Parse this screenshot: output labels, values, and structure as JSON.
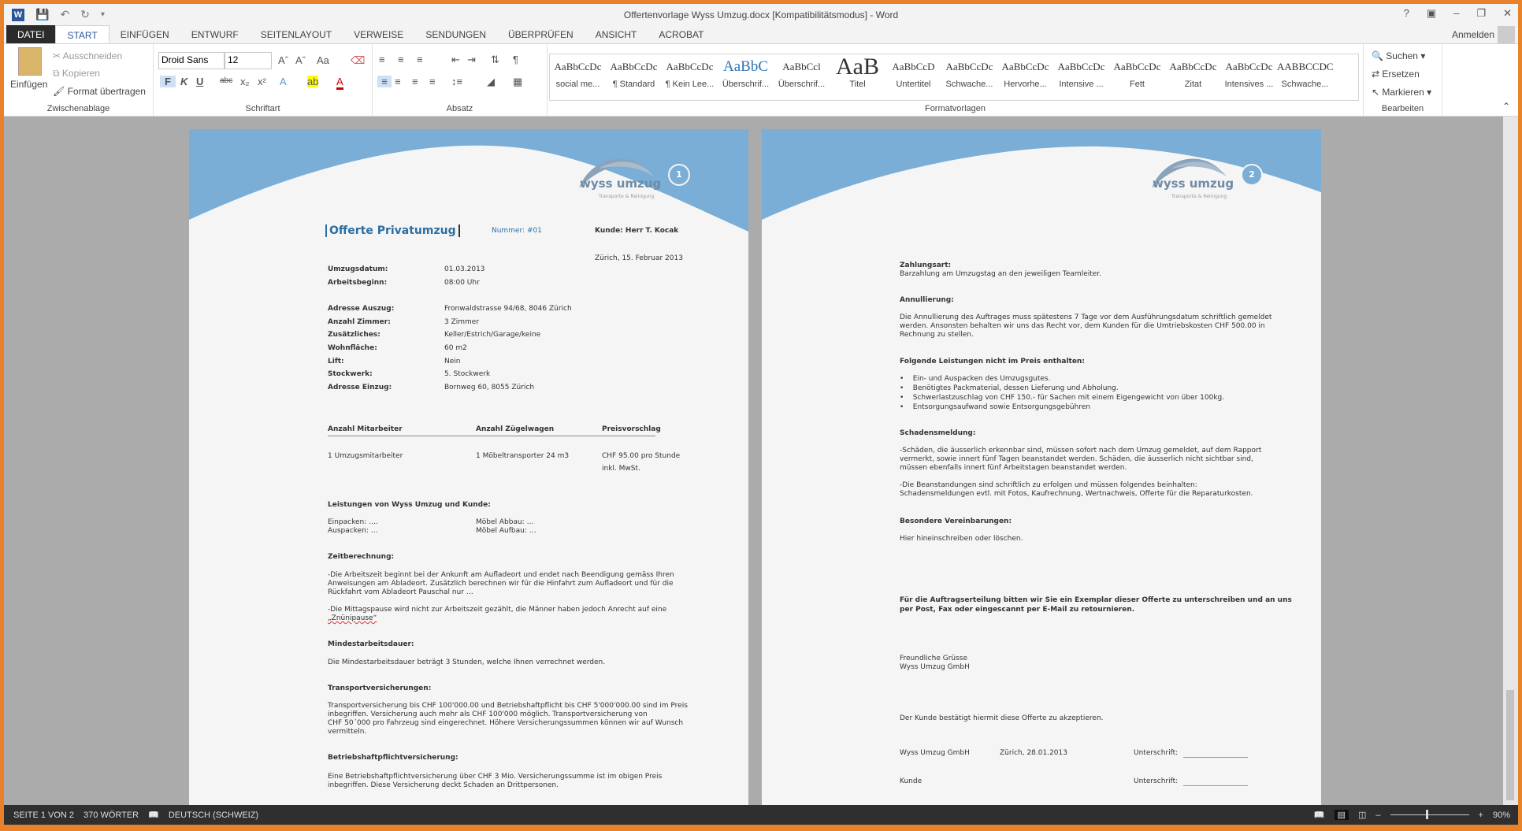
{
  "window": {
    "title": "Offertenvorlage Wyss Umzug.docx [Kompatibilitätsmodus] - Word",
    "help": "?",
    "signin": "Anmelden"
  },
  "tabs": [
    "DATEI",
    "START",
    "EINFÜGEN",
    "ENTWURF",
    "SEITENLAYOUT",
    "VERWEISE",
    "SENDUNGEN",
    "ÜBERPRÜFEN",
    "ANSICHT",
    "ACROBAT"
  ],
  "ribbon": {
    "clipboard": {
      "paste": "Einfügen",
      "cut": "Ausschneiden",
      "copy": "Kopieren",
      "format_painter": "Format übertragen",
      "label": "Zwischenablage"
    },
    "font": {
      "name": "Droid Sans",
      "size": "12",
      "label": "Schriftart",
      "bold": "F",
      "italic": "K",
      "underline": "U",
      "strike": "abc",
      "case": "Aa"
    },
    "paragraph": {
      "label": "Absatz"
    },
    "styles": {
      "label": "Formatvorlagen",
      "items": [
        {
          "preview": "AaBbCcDc",
          "name": "social me..."
        },
        {
          "preview": "AaBbCcDc",
          "name": "¶ Standard"
        },
        {
          "preview": "AaBbCcDc",
          "name": "¶ Kein Lee..."
        },
        {
          "preview": "AaBbC",
          "name": "Überschrif..."
        },
        {
          "preview": "AaBbCcl",
          "name": "Überschrif..."
        },
        {
          "preview": "AaB",
          "name": "Titel"
        },
        {
          "preview": "AaBbCcD",
          "name": "Untertitel"
        },
        {
          "preview": "AaBbCcDc",
          "name": "Schwache..."
        },
        {
          "preview": "AaBbCcDc",
          "name": "Hervorhe..."
        },
        {
          "preview": "AaBbCcDc",
          "name": "Intensive ..."
        },
        {
          "preview": "AaBbCcDc",
          "name": "Fett"
        },
        {
          "preview": "AaBbCcDc",
          "name": "Zitat"
        },
        {
          "preview": "AaBbCcDc",
          "name": "Intensives ..."
        },
        {
          "preview": "AABBCCDC",
          "name": "Schwache..."
        }
      ]
    },
    "editing": {
      "find": "Suchen",
      "replace": "Ersetzen",
      "select": "Markieren",
      "label": "Bearbeiten"
    }
  },
  "page1": {
    "logo": "wyss umzug",
    "logo_sub": "Transporte & Reinigung",
    "number": "1",
    "title": "Offerte Privatumzug",
    "nummer": "Nummer: #01",
    "kunde": "Kunde: Herr T. Kocak",
    "date": "Zürich, 15. Februar 2013",
    "fields": [
      [
        "Umzugsdatum:",
        "01.03.2013"
      ],
      [
        "Arbeitsbeginn:",
        "08:00 Uhr"
      ],
      [
        "Adresse Auszug:",
        "Fronwaldstrasse 94/68, 8046 Zürich"
      ],
      [
        "Anzahl Zimmer:",
        "3 Zimmer"
      ],
      [
        "Zusätzliches:",
        "Keller/Estrich/Garage/keine"
      ],
      [
        "Wohnfläche:",
        "60 m2"
      ],
      [
        "Lift:",
        "Nein"
      ],
      [
        "Stockwerk:",
        "5. Stockwerk"
      ],
      [
        "Adresse Einzug:",
        "Bornweg 60, 8055 Zürich"
      ]
    ],
    "table": {
      "headers": [
        "Anzahl Mitarbeiter",
        "Anzahl Zügelwagen",
        "Preisvorschlag"
      ],
      "row": [
        "1 Umzugsmitarbeiter",
        "1 Möbeltransporter 24 m3",
        "CHF 95.00 pro Stunde",
        "inkl. MwSt."
      ]
    },
    "leistungen": {
      "heading": "Leistungen von Wyss Umzug und Kunde:",
      "items": [
        "Einpacken: ….",
        "Auspacken: …",
        "Möbel Abbau: …",
        "Möbel Aufbau: …"
      ]
    },
    "zeit": {
      "heading": "Zeitberechnung:",
      "lines": [
        "-Die Arbeitszeit beginnt bei der Ankunft am Aufladeort und endet nach Beendigung gemäss Ihren",
        "Anweisungen am Abladeort. Zusätzlich berechnen wir für die Hinfahrt zum Aufladeort und für die",
        "Rückfahrt vom Abladeort Pauschal nur …",
        "-Die Mittagspause wird nicht zur Arbeitszeit gezählt, die Männer haben jedoch Anrecht auf eine",
        "„Znünipause“"
      ]
    },
    "mindest": {
      "heading": "Mindestarbeitsdauer:",
      "text": "Die Mindestarbeitsdauer beträgt 3 Stunden, welche Ihnen verrechnet werden."
    },
    "transport": {
      "heading": "Transportversicherungen:",
      "lines": [
        "Transportversicherung bis CHF 100'000.00 und Betriebshaftpflicht bis CHF 5'000'000.00 sind im Preis",
        "inbegriffen. Versicherung auch mehr als CHF 100'000 möglich. Transportversicherung von",
        "CHF 50´000 pro Fahrzeug sind eingerechnet. Höhere Versicherungssummen können wir auf Wunsch",
        "vermitteln."
      ]
    },
    "betrieb": {
      "heading": "Betriebshaftpflichtversicherung:",
      "lines": [
        "Eine Betriebshaftpflichtversicherung über CHF 3 Mio. Versicherungssumme ist im obigen Preis",
        "inbegriffen. Diese Versicherung deckt Schaden an Drittpersonen."
      ]
    }
  },
  "page2": {
    "logo": "wyss umzug",
    "logo_sub": "Transporte & Reinigung",
    "number": "2",
    "zahlung": {
      "heading": "Zahlungsart:",
      "text": "Barzahlung am Umzugstag an den jeweiligen Teamleiter."
    },
    "annul": {
      "heading": "Annullierung:",
      "lines": [
        "Die Annullierung des Auftrages muss spätestens 7 Tage vor dem Ausführungsdatum schriftlich gemeldet",
        "werden. Ansonsten behalten wir uns das Recht vor, dem Kunden für die Umtriebskosten CHF 500.00 in",
        "Rechnung zu stellen."
      ]
    },
    "folgende": {
      "heading": "Folgende Leistungen nicht im Preis enthalten:",
      "items": [
        "Ein- und Auspacken des Umzugsgutes.",
        "Benötigtes Packmaterial, dessen Lieferung und Abholung.",
        "Schwerlastzuschlag von CHF 150.- für Sachen mit einem Eigengewicht von über 100kg.",
        "Entsorgungsaufwand sowie Entsorgungsgebühren"
      ]
    },
    "schaden": {
      "heading": "Schadensmeldung:",
      "lines": [
        "-Schäden, die äusserlich erkennbar sind, müssen sofort nach dem Umzug gemeldet, auf dem Rapport",
        "vermerkt, sowie innert fünf Tagen beanstandet werden. Schäden, die äusserlich nicht sichtbar sind,",
        "müssen ebenfalls innert fünf Arbeitstagen beanstandet werden.",
        "-Die Beanstandungen sind schriftlich zu erfolgen und müssen folgendes beinhalten:",
        "Schadensmeldungen evtl. mit Fotos, Kaufrechnung, Wertnachweis, Offerte für die Reparaturkosten."
      ]
    },
    "besondere": {
      "heading": "Besondere Vereinbarungen:",
      "text": "Hier hineinschreiben oder löschen."
    },
    "auftrag": [
      "Für die Auftragserteilung bitten wir Sie ein Exemplar dieser Offerte zu unterschreiben und an uns",
      "per Post, Fax oder eingescannt per E-Mail zu retournieren."
    ],
    "gruss": [
      "Freundliche Grüsse",
      "Wyss Umzug GmbH"
    ],
    "bestaetigt": "Der Kunde bestätigt hiermit diese Offerte zu akzeptieren.",
    "sign": {
      "company": "Wyss Umzug GmbH",
      "date": "Zürich, 28.01.2013",
      "label": "Unterschrift:",
      "kunde": "Kunde"
    }
  },
  "status": {
    "page": "SEITE 1 VON 2",
    "words": "370 WÖRTER",
    "language": "DEUTSCH (SCHWEIZ)",
    "zoom": "90%",
    "zoom_percent": 90
  },
  "colors": {
    "accent": "#2b579a",
    "header_blue": "#7aaed6",
    "frame": "#e8822a"
  }
}
